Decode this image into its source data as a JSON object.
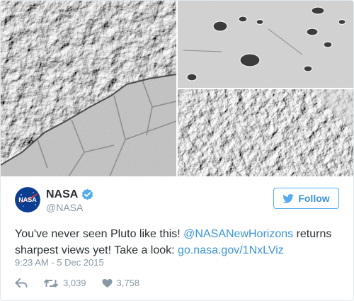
{
  "tweet": {
    "images": [
      {
        "icon": "pluto-terrain-photo"
      },
      {
        "icon": "pluto-craters-photo"
      },
      {
        "icon": "pluto-mountains-photo"
      }
    ],
    "author": {
      "display_name": "NASA",
      "screen_name": "@NASA",
      "avatar_text": "NASA",
      "verified": true
    },
    "follow_label": "Follow",
    "text_parts": {
      "part1": "You've never seen Pluto like this! ",
      "mention": "@NASANewHorizons",
      "part2": " returns sharpest views yet! Take a look: ",
      "link": "go.nasa.gov/1NxLViz"
    },
    "timestamp": "9:23 AM - 5 Dec 2015",
    "stats": {
      "retweets": "3,039",
      "likes": "3,758"
    }
  },
  "colors": {
    "link": "#3b94d9",
    "muted": "#8899a6",
    "text": "#292f33",
    "verified": "#55acee",
    "border": "#e1e8ed"
  }
}
